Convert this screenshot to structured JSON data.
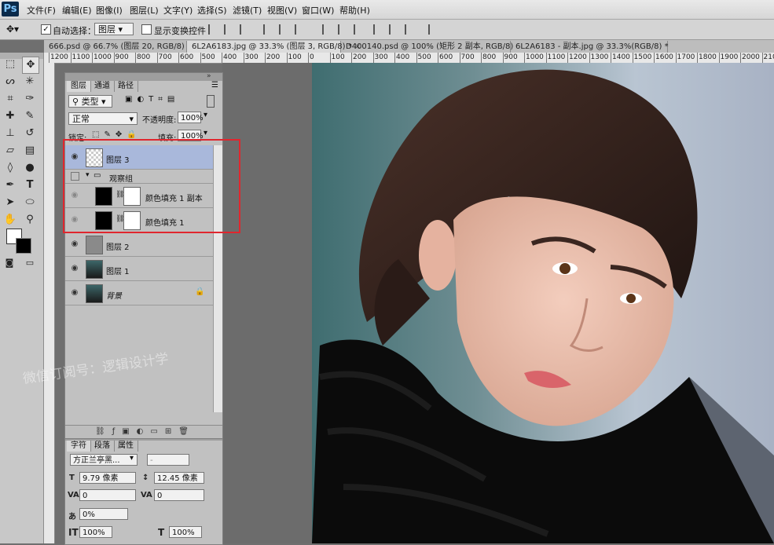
{
  "app": {
    "logo": "Ps"
  },
  "menu": [
    "文件(F)",
    "编辑(E)",
    "图像(I)",
    "图层(L)",
    "文字(Y)",
    "选择(S)",
    "滤镜(T)",
    "视图(V)",
    "窗口(W)",
    "帮助(H)"
  ],
  "options": {
    "auto_select_label": "自动选择：",
    "auto_select_target": "图层",
    "show_transform_label": "显示变换控件"
  },
  "tabs": [
    "666.psd @ 66.7% (图层 20, RGB/8) *",
    "6L2A6183.jpg @ 33.3% (图层 3, RGB/8) *",
    "D400140.psd @ 100% (矩形 2 副本, RGB/8)",
    "6L2A6183 - 副本.jpg @ 33.3%(RGB/8) *"
  ],
  "ruler_labels": [
    "1200",
    "1100",
    "1000",
    "900",
    "800",
    "700",
    "600",
    "500",
    "400",
    "300",
    "200",
    "100",
    "0",
    "100",
    "200",
    "300",
    "400",
    "500",
    "600",
    "700",
    "800",
    "900",
    "1000",
    "1100",
    "1200",
    "1300",
    "1400",
    "1500",
    "1600",
    "1700",
    "1800",
    "1900",
    "2000",
    "2100"
  ],
  "layers_panel": {
    "tabs": [
      "图层",
      "通道",
      "路径"
    ],
    "filter_kind": "类型",
    "blend_mode": "正常",
    "opacity_label": "不透明度:",
    "opacity_value": "100%",
    "lock_label": "锁定:",
    "fill_label": "填充:",
    "fill_value": "100%",
    "layers": [
      {
        "name": "图层 3",
        "selected": true
      },
      {
        "name": "观察组",
        "group": true
      },
      {
        "name": "颜色填充 1 副本",
        "indent": true,
        "mask": true
      },
      {
        "name": "颜色填充 1",
        "indent": true,
        "mask": true
      },
      {
        "name": "图层 2"
      },
      {
        "name": "图层 1"
      },
      {
        "name": "背景",
        "locked": true
      }
    ]
  },
  "char_panel": {
    "tabs": [
      "字符",
      "段落",
      "属性"
    ],
    "font_family": "方正兰亭黑...",
    "font_style": "-",
    "font_size": "9.79 像素",
    "leading": "12.45 像素",
    "kerning": "0",
    "tracking": "0",
    "vscale_pct": "0%",
    "hscale": "100%",
    "vscale": "100%"
  },
  "watermark": "微信订阅号：逻辑设计学"
}
